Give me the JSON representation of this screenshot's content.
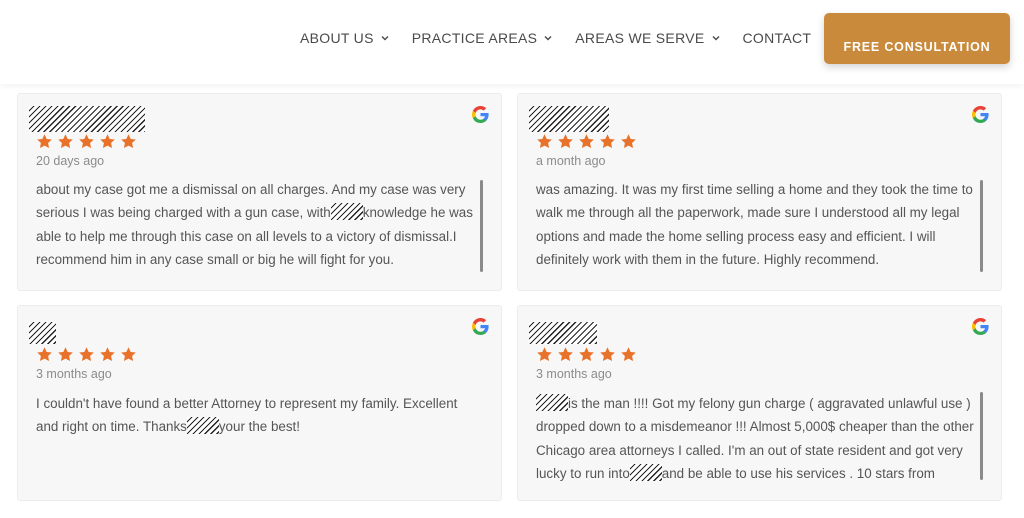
{
  "header": {
    "nav": [
      {
        "label": "ABOUT US",
        "has_dropdown": true
      },
      {
        "label": "PRACTICE AREAS",
        "has_dropdown": true
      },
      {
        "label": "AREAS WE SERVE",
        "has_dropdown": true
      },
      {
        "label": "CONTACT",
        "has_dropdown": false
      }
    ],
    "cta_label": "FREE CONSULTATION",
    "cta_color": "#c98a3c"
  },
  "reviews": [
    {
      "rating": 5,
      "date": "20 days ago",
      "source_icon": "google-icon",
      "text_1": "about my case got me a dismissal on all charges. And my case was very serious I was being charged with a gun case, with",
      "text_2": "knowledge he was able to help me through this case on all levels to a victory of dismissal.I recommend him in any case small or big he will fight for you."
    },
    {
      "rating": 5,
      "date": "a month ago",
      "source_icon": "google-icon",
      "text_1": "was amazing. It was my first time selling a home and they took the time to walk me through all the paperwork, made sure I understood all my legal options and made the home selling process easy and efficient. I will definitely work with them in the future. Highly recommend."
    },
    {
      "rating": 5,
      "date": "3 months ago",
      "source_icon": "google-icon",
      "text_1": "I couldn't have found a better Attorney to represent my family. Excellent and right on time. Thanks",
      "text_2": "your the best!"
    },
    {
      "rating": 5,
      "date": "3 months ago",
      "source_icon": "google-icon",
      "text_1": "is the man !!!! Got my felony gun charge ( aggravated unlawful use ) dropped down to a misdemeanor !!! Almost 5,000$ cheaper than the other Chicago area attorneys I called. I'm an out of state resident and got very lucky to run into",
      "text_2": "and be able to use his services . 10 stars from"
    }
  ],
  "colors": {
    "star": "#e8722a",
    "card_bg": "#f7f7f7"
  }
}
